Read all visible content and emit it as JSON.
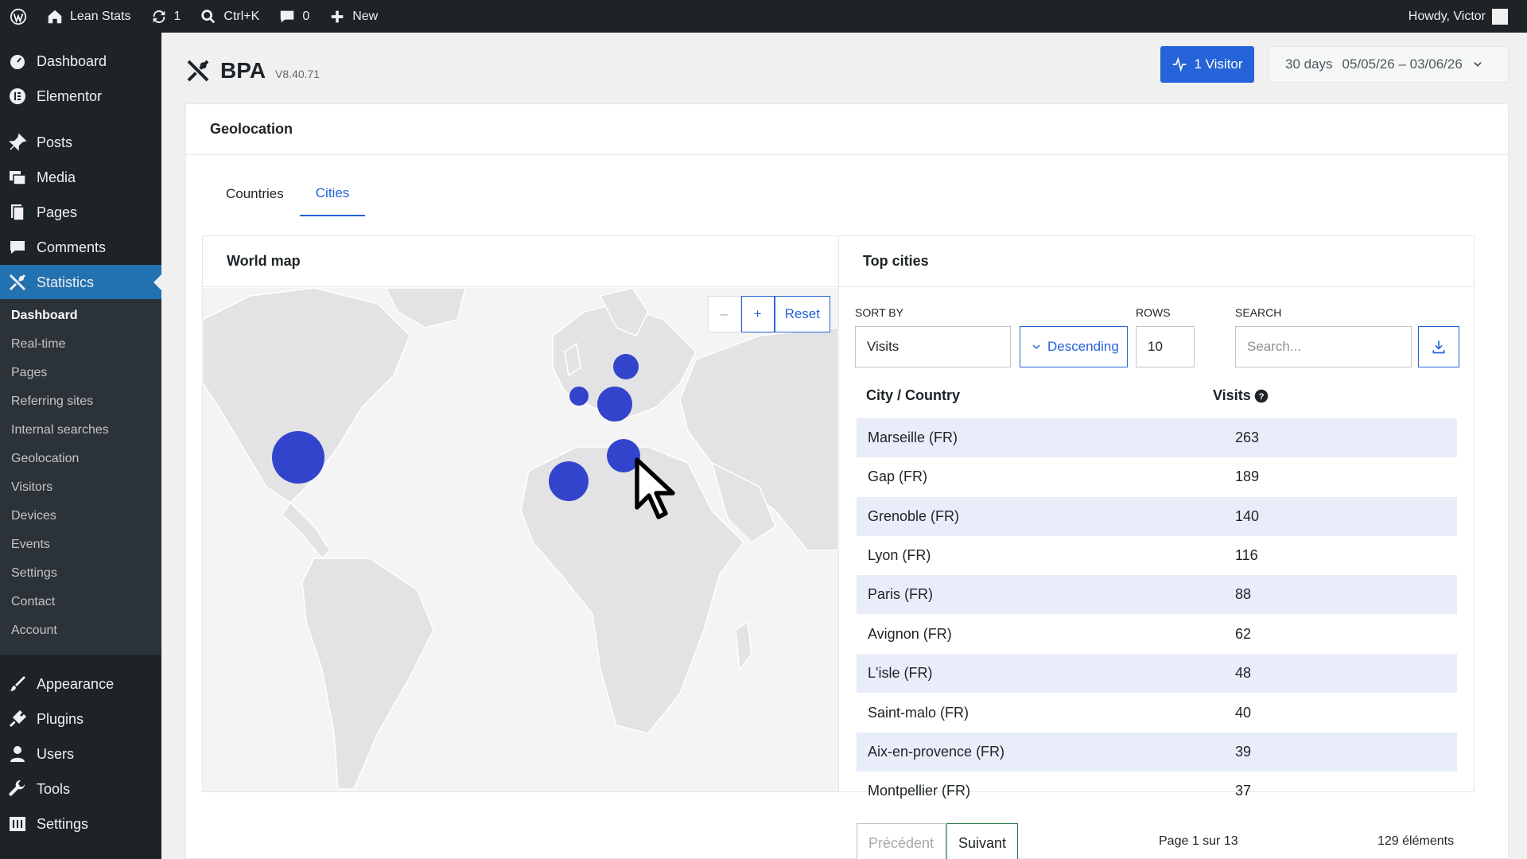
{
  "admin_bar": {
    "site_name": "Lean Stats",
    "updates_count": "1",
    "search_shortcut": "Ctrl+K",
    "comments_count": "0",
    "new_label": "New",
    "greeting": "Howdy, Victor"
  },
  "sidebar": {
    "items": [
      {
        "label": "Dashboard",
        "icon": "dashboard-icon"
      },
      {
        "label": "Elementor",
        "icon": "elementor-icon"
      },
      {
        "label": "Posts",
        "icon": "pin-icon"
      },
      {
        "label": "Media",
        "icon": "media-icon"
      },
      {
        "label": "Pages",
        "icon": "pages-icon"
      },
      {
        "label": "Comments",
        "icon": "comment-icon"
      },
      {
        "label": "Statistics",
        "icon": "statistics-icon"
      },
      {
        "label": "Appearance",
        "icon": "brush-icon"
      },
      {
        "label": "Plugins",
        "icon": "plug-icon"
      },
      {
        "label": "Users",
        "icon": "user-icon"
      },
      {
        "label": "Tools",
        "icon": "wrench-icon"
      },
      {
        "label": "Settings",
        "icon": "settings-icon"
      }
    ],
    "submenu": [
      "Dashboard",
      "Real-time",
      "Pages",
      "Referring sites",
      "Internal searches",
      "Geolocation",
      "Visitors",
      "Devices",
      "Events",
      "Settings",
      "Contact",
      "Account"
    ]
  },
  "header": {
    "logo_text": "BPA",
    "version": "V8.40.71",
    "visitor_button": "1 Visitor",
    "range_label": "30 days",
    "date_range": "05/05/26 – 03/06/26"
  },
  "geolocation": {
    "title": "Geolocation",
    "tabs": [
      "Countries",
      "Cities"
    ],
    "active_tab": "Cities"
  },
  "map": {
    "title": "World map",
    "zoom_out": "–",
    "zoom_in": "+",
    "reset": "Reset"
  },
  "top_cities": {
    "title": "Top cities",
    "sort_by_label": "SORT BY",
    "sort_by_value": "Visits",
    "order_value": "Descending",
    "rows_label": "ROWS",
    "rows_value": "10",
    "search_label": "SEARCH",
    "search_placeholder": "Search...",
    "columns": [
      "City / Country",
      "Visits"
    ],
    "rows": [
      {
        "city": "Marseille (FR)",
        "visits": "263"
      },
      {
        "city": "Gap (FR)",
        "visits": "189"
      },
      {
        "city": "Grenoble (FR)",
        "visits": "140"
      },
      {
        "city": "Lyon (FR)",
        "visits": "116"
      },
      {
        "city": "Paris (FR)",
        "visits": "88"
      },
      {
        "city": "Avignon (FR)",
        "visits": "62"
      },
      {
        "city": "L'isle (FR)",
        "visits": "48"
      },
      {
        "city": "Saint-malo (FR)",
        "visits": "40"
      },
      {
        "city": "Aix-en-provence (FR)",
        "visits": "39"
      },
      {
        "city": "Montpellier (FR)",
        "visits": "37"
      }
    ],
    "prev_label": "Précédent",
    "next_label": "Suivant",
    "page_info": "Page 1 sur 13",
    "total_info": "129 éléments"
  },
  "colors": {
    "accent": "#2563d8",
    "marker": "#3344cc",
    "sidebar_bg": "#1d2327",
    "row_stripe": "#e8edf9"
  }
}
